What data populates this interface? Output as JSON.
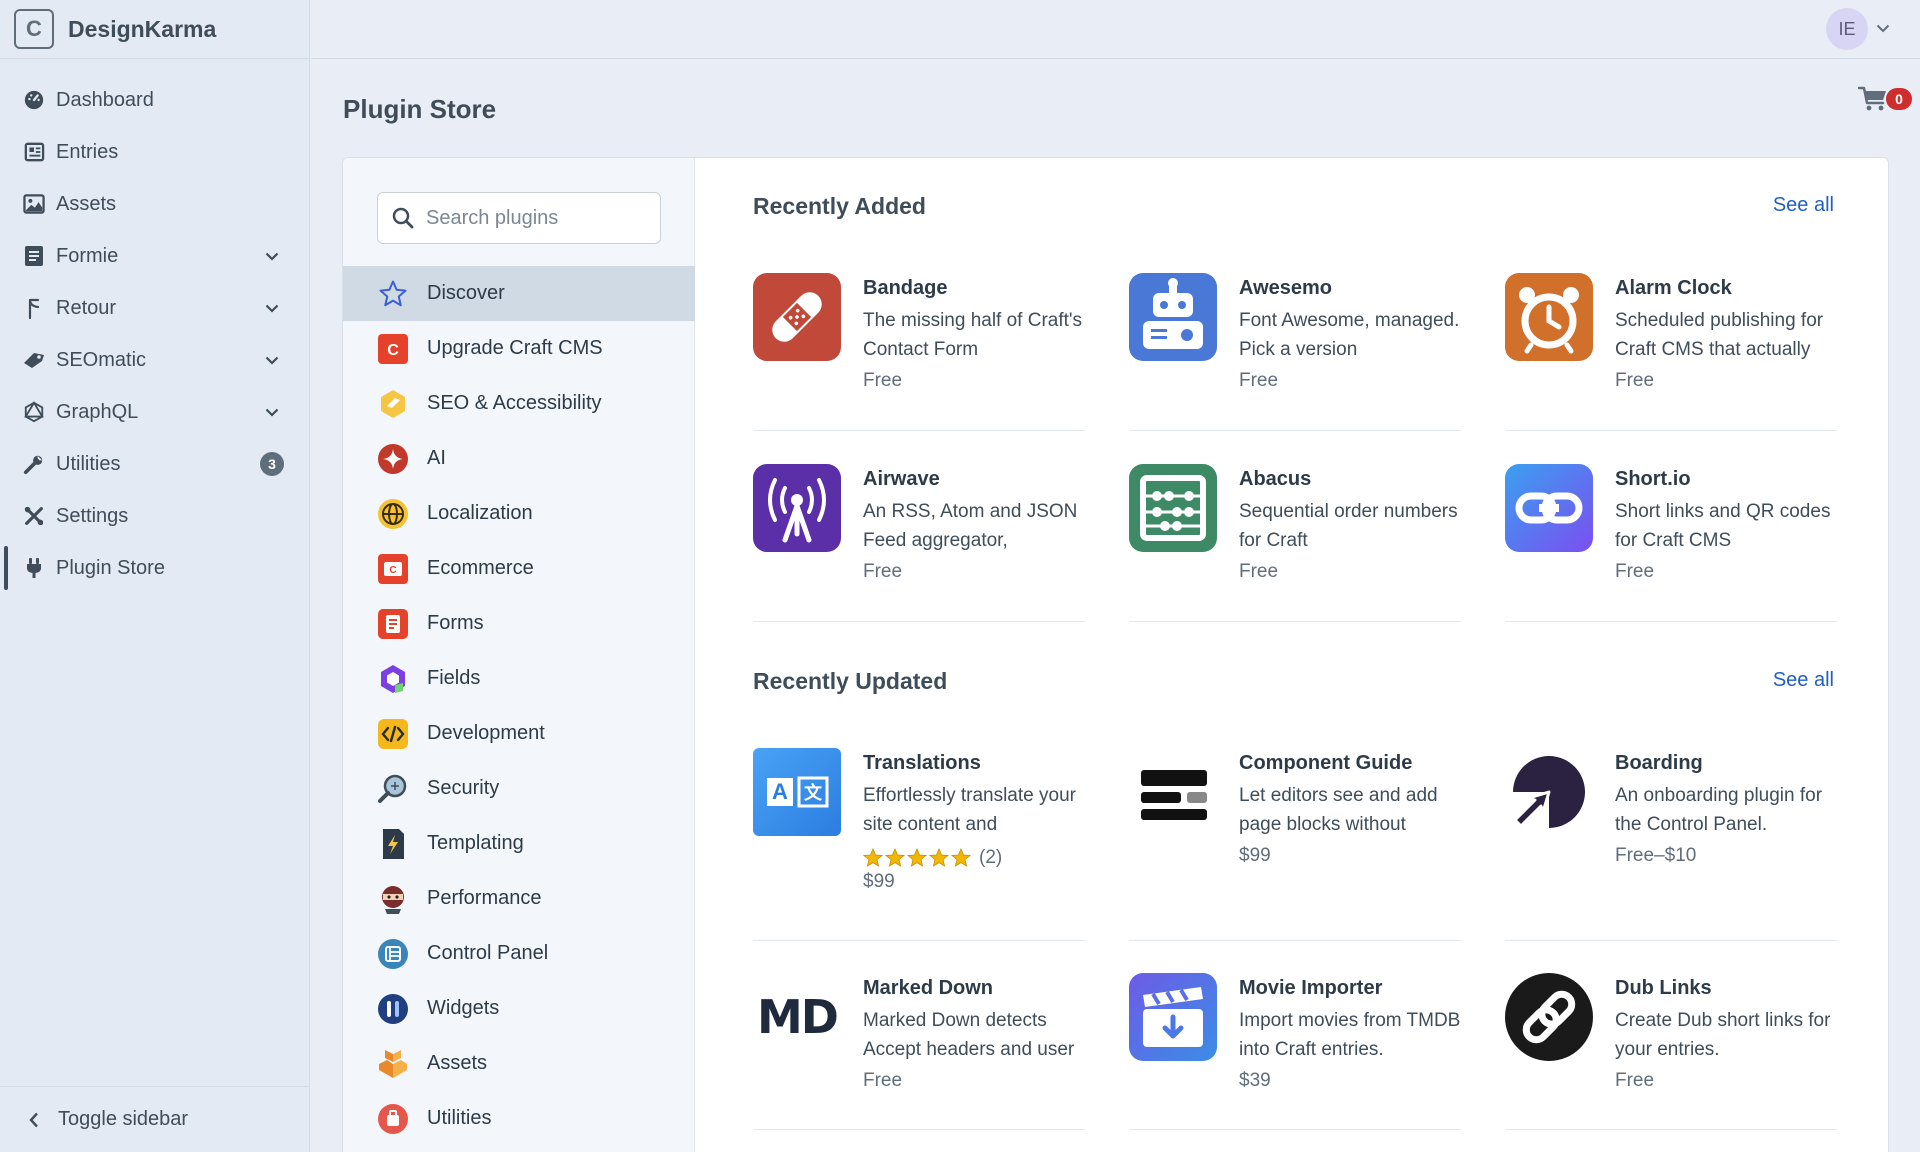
{
  "app": {
    "logo_letter": "C",
    "site_name": "DesignKarma"
  },
  "sidebar": {
    "items": [
      {
        "label": "Dashboard"
      },
      {
        "label": "Entries"
      },
      {
        "label": "Assets"
      },
      {
        "label": "Formie"
      },
      {
        "label": "Retour"
      },
      {
        "label": "SEOmatic"
      },
      {
        "label": "GraphQL"
      },
      {
        "label": "Utilities",
        "badge": "3"
      },
      {
        "label": "Settings"
      },
      {
        "label": "Plugin Store"
      }
    ],
    "toggle_label": "Toggle sidebar"
  },
  "user": {
    "initials": "IE"
  },
  "page": {
    "title": "Plugin Store",
    "cart_count": "0"
  },
  "search": {
    "placeholder": "Search plugins"
  },
  "categories": [
    "Discover",
    "Upgrade Craft CMS",
    "SEO & Accessibility",
    "AI",
    "Localization",
    "Ecommerce",
    "Forms",
    "Fields",
    "Development",
    "Security",
    "Templating",
    "Performance",
    "Control Panel",
    "Widgets",
    "Assets",
    "Utilities"
  ],
  "recently_added": {
    "title": "Recently Added",
    "see_all": "See all",
    "plugins": [
      {
        "name": "Bandage",
        "desc": "The missing half of Craft's Contact Form",
        "price": "Free"
      },
      {
        "name": "Awesemo",
        "desc": "Font Awesome, managed. Pick a version",
        "price": "Free"
      },
      {
        "name": "Alarm Clock",
        "desc": "Scheduled publishing for Craft CMS that actually",
        "price": "Free"
      },
      {
        "name": "Airwave",
        "desc": "An RSS, Atom and JSON Feed aggregator,",
        "price": "Free"
      },
      {
        "name": "Abacus",
        "desc": "Sequential order numbers for Craft",
        "price": "Free"
      },
      {
        "name": "Short.io",
        "desc": "Short links and QR codes for Craft CMS",
        "price": "Free"
      }
    ]
  },
  "recently_updated": {
    "title": "Recently Updated",
    "see_all": "See all",
    "plugins": [
      {
        "name": "Translations",
        "desc": "Effortlessly translate your site content and",
        "rating_count": "(2)",
        "rating": 5,
        "price": "$99"
      },
      {
        "name": "Component Guide",
        "desc": "Let editors see and add page blocks without",
        "price": "$99"
      },
      {
        "name": "Boarding",
        "desc": "An onboarding plugin for the Control Panel.",
        "price": "Free–$10"
      },
      {
        "name": "Marked Down",
        "desc": "Marked Down detects Accept headers and user",
        "price": "Free",
        "icon_text": "MD"
      },
      {
        "name": "Movie Importer",
        "desc": "Import movies from TMDB into Craft entries.",
        "price": "$39"
      },
      {
        "name": "Dub Links",
        "desc": "Create Dub short links for your entries.",
        "price": "Free"
      }
    ]
  },
  "colors": {
    "accent": "#1f5fbf",
    "cart_badge": "#cf2e2e",
    "star": "#f2b705"
  }
}
